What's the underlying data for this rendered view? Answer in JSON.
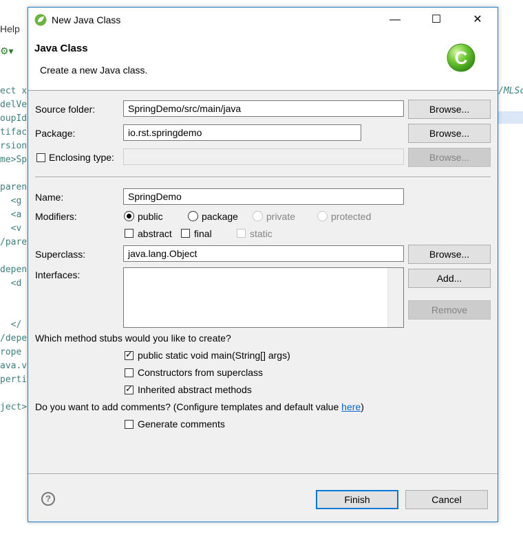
{
  "background": {
    "menu": "Help",
    "lines": [
      "ect x",
      "delVe",
      "oupId",
      "tifac",
      "rsion",
      "me>Sp",
      "",
      "paren",
      "  <g",
      "  <a",
      "  <v",
      "/pare",
      "",
      "depen",
      "  <d",
      "",
      "",
      "  </",
      "/depe",
      "rope",
      "ava.v",
      "perti",
      "",
      "ject>"
    ],
    "right_text": "/MLSc"
  },
  "dialog": {
    "title": "New Java Class",
    "minimize": "—",
    "maximize": "☐",
    "close": "✕",
    "banner_title": "Java Class",
    "banner_desc": "Create a new Java class.",
    "source_folder_label": "Source folder:",
    "source_folder_value": "SpringDemo/src/main/java",
    "package_label": "Package:",
    "package_value": "io.rst.springdemo",
    "enclosing_label": "Enclosing type:",
    "enclosing_value": "",
    "browse": "Browse...",
    "name_label": "Name:",
    "name_value": "SpringDemo",
    "modifiers_label": "Modifiers:",
    "mod_public": "public",
    "mod_package": "package",
    "mod_private": "private",
    "mod_protected": "protected",
    "mod_abstract": "abstract",
    "mod_final": "final",
    "mod_static": "static",
    "superclass_label": "Superclass:",
    "superclass_value": "java.lang.Object",
    "interfaces_label": "Interfaces:",
    "add_button": "Add...",
    "remove_button": "Remove",
    "stubs_question": "Which method stubs would you like to create?",
    "stub_main": "public static void main(String[] args)",
    "stub_constructors": "Constructors from superclass",
    "stub_inherited": "Inherited abstract methods",
    "comments_question_pre": "Do you want to add comments? (Configure templates and default value ",
    "comments_link": "here",
    "comments_question_post": ")",
    "generate_comments": "Generate comments",
    "finish_button": "Finish",
    "cancel_button": "Cancel",
    "help_icon_glyph": "?"
  },
  "colors": {
    "accent": "#0078d7",
    "frame": "#1979ca",
    "dialog_bg": "#f0f0f0",
    "logo_green": "#6cc62f"
  },
  "state": {
    "modifier_selected": "public",
    "stub_main_checked": true,
    "stub_constructors_checked": false,
    "stub_inherited_checked": true,
    "generate_comments_checked": false,
    "enclosing_checked": false,
    "abstract_checked": false,
    "final_checked": false,
    "static_checked": false
  }
}
